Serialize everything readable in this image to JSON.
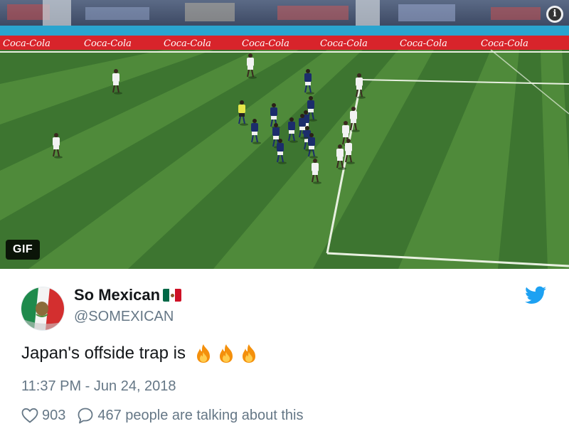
{
  "media": {
    "badge": "GIF",
    "board_text": "Coca-Cola",
    "info_label": "i"
  },
  "tweet": {
    "author_name": "So Mexican",
    "author_handle": "@SOMEXICAN",
    "text": "Japan's offside trap is",
    "text_emoji": [
      "fire",
      "fire",
      "fire"
    ],
    "timestamp": "11:37 PM - Jun 24, 2018",
    "likes": "903",
    "replies_text": "467 people are talking about this"
  },
  "icons": {
    "like": "heart-icon",
    "reply": "comment-bubble-icon",
    "brand": "twitter-bird-icon",
    "info": "info-icon",
    "flag": "mexico-flag-icon"
  },
  "colors": {
    "twitter_blue": "#1da1f2",
    "secondary_text": "#657786",
    "primary_text": "#14171a",
    "pitch_light": "#4f8a3a",
    "pitch_dark": "#3d7530",
    "board_red": "#d8242b",
    "japan_kit": "#1c2d6b",
    "senegal_kit": "#f2f2f2"
  }
}
